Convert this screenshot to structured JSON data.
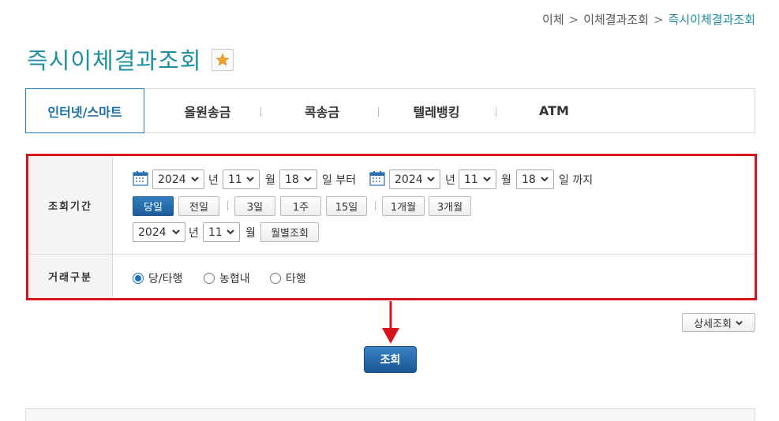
{
  "breadcrumb": {
    "item1": "이체",
    "item2": "이체결과조회",
    "current": "즉시이체결과조회",
    "separator": ">"
  },
  "page_title": "즉시이체결과조회",
  "tabs": [
    "인터넷/스마트",
    "올원송금",
    "콕송금",
    "텔레뱅킹",
    "ATM"
  ],
  "period": {
    "label": "조회기간",
    "from": {
      "year": "2024",
      "month": "11",
      "day": "18"
    },
    "to": {
      "year": "2024",
      "month": "11",
      "day": "18"
    },
    "units": {
      "year": "년",
      "month": "월",
      "day_from": "일 부터",
      "day_to": "일 까지"
    },
    "quick": [
      "당일",
      "전일",
      "3일",
      "1주",
      "15일",
      "1개월",
      "3개월"
    ],
    "monthly": {
      "year": "2024",
      "month": "11",
      "button": "월별조회"
    }
  },
  "txn_type": {
    "label": "거래구분",
    "options": [
      "당/타행",
      "농협내",
      "타행"
    ],
    "selected": "당/타행"
  },
  "detail_button": "상세조회",
  "search_button": "조회",
  "colors": {
    "accent": "#1d8fa1",
    "highlight": "#d9131d",
    "primary_button": "#1a5796"
  }
}
